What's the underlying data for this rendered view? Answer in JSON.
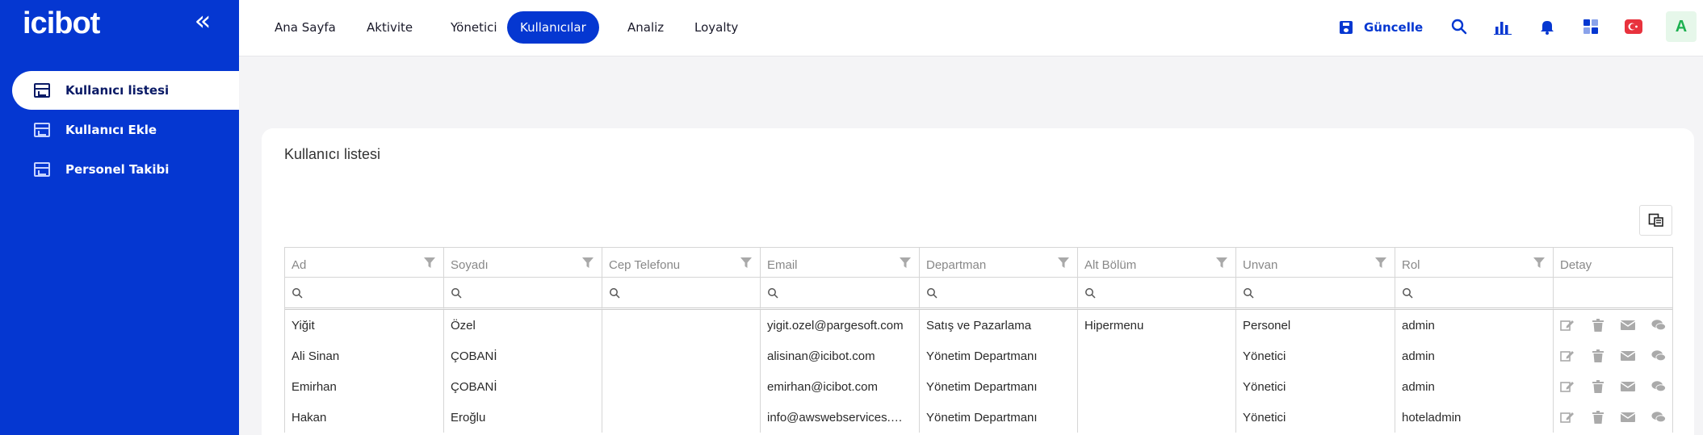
{
  "app": {
    "logo_text": "icibot",
    "collapse_glyph": "«"
  },
  "sidebar": {
    "items": [
      {
        "label": "Kullanıcı listesi",
        "icon": "table-icon",
        "active": true
      },
      {
        "label": "Kullanıcı Ekle",
        "icon": "table-icon",
        "active": false
      },
      {
        "label": "Personel Takibi",
        "icon": "table-icon",
        "active": false
      }
    ]
  },
  "topnav": {
    "items": [
      {
        "label": "Ana Sayfa"
      },
      {
        "label": "Aktivite"
      },
      {
        "label": "Yönetici"
      },
      {
        "label": "Kullanıcılar",
        "active": true
      },
      {
        "label": "Analiz"
      },
      {
        "label": "Loyalty"
      }
    ],
    "update_label": "Güncelle",
    "avatar_letter": "A",
    "icons": [
      "search-icon",
      "chart-icon",
      "bell-icon",
      "apps-grid-icon",
      "turkish-flag-icon"
    ]
  },
  "card": {
    "title": "Kullanıcı listesi"
  },
  "table": {
    "columns": [
      "Ad",
      "Soyadı",
      "Cep Telefonu",
      "Email",
      "Departman",
      "Alt Bölüm",
      "Unvan",
      "Rol",
      "Detay"
    ],
    "rows": [
      [
        "Yiğit",
        "Özel",
        "",
        "yigit.ozel@pargesoft.com",
        "Satış ve Pazarlama",
        "Hipermenu",
        "Personel",
        "admin"
      ],
      [
        "Ali Sinan",
        "ÇOBANİ",
        "",
        "alisinan@icibot.com",
        "Yönetim Departmanı",
        "",
        "Yönetici",
        "admin"
      ],
      [
        "Emirhan",
        "ÇOBANİ",
        "",
        "emirhan@icibot.com",
        "Yönetim Departmanı",
        "",
        "Yönetici",
        "admin"
      ],
      [
        "Hakan",
        "Eroğlu",
        "",
        "info@awswebservices.…",
        "Yönetim Departmanı",
        "",
        "Yönetici",
        "hoteladmin"
      ]
    ],
    "row_actions": [
      "edit-icon",
      "delete-icon",
      "mail-icon",
      "chat-icon"
    ]
  },
  "colors": {
    "brand": "#0537d1",
    "avatar_bg": "#e6f7ea",
    "avatar_fg": "#1db050",
    "flag_red": "#e8323d"
  }
}
